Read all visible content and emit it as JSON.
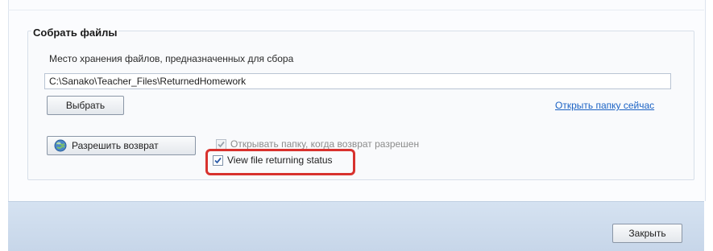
{
  "group": {
    "title": "Собрать файлы",
    "path_label": "Место хранения файлов, предназначенных для сбора",
    "path_value": "C:\\Sanako\\Teacher_Files\\ReturnedHomework",
    "choose_button": "Выбрать",
    "open_folder_link": "Открыть папку сейчас",
    "allow_return_button": "Разрешить возврат",
    "checkbox_open_folder": {
      "label": "Открывать папку, когда возврат разрешен",
      "checked": true,
      "enabled": false
    },
    "checkbox_view_status": {
      "label": "View file returning status",
      "checked": true,
      "enabled": true
    }
  },
  "footer": {
    "close_button": "Закрыть"
  },
  "colors": {
    "highlight": "#d8322e",
    "link": "#1b62c4",
    "band": "#cfdcee"
  },
  "icons": {
    "allow_return": "globe-icon",
    "check": "check-icon"
  }
}
